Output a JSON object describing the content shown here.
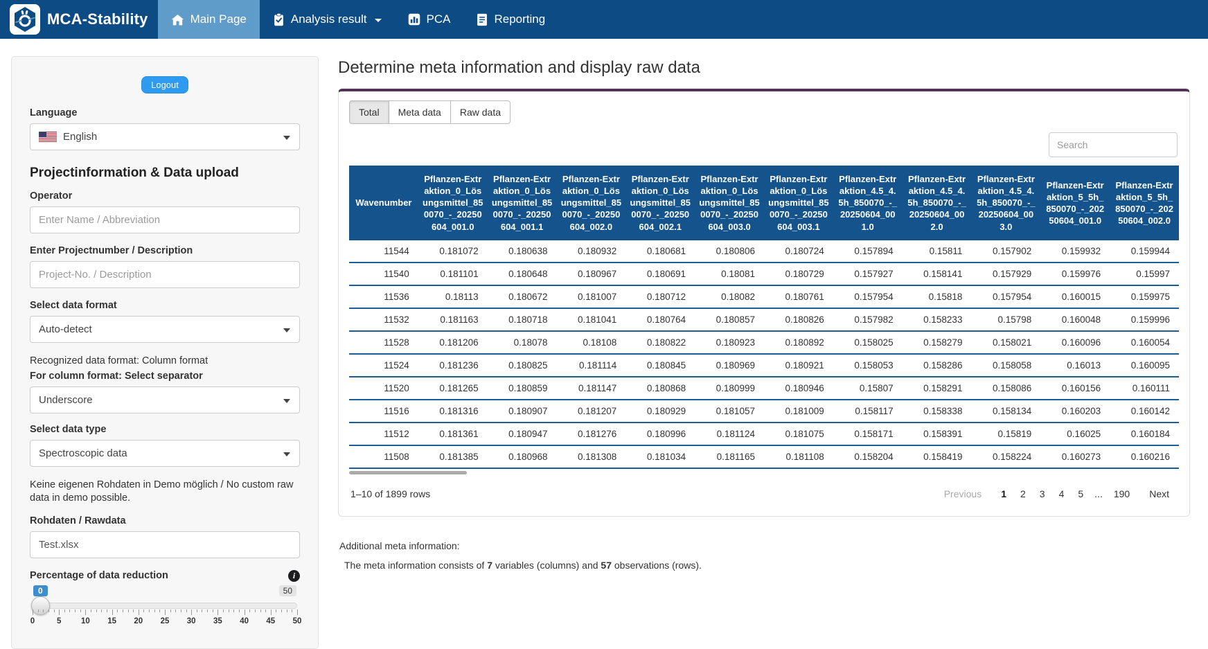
{
  "navbar": {
    "brand": "MCA-Stability",
    "items": [
      {
        "label": "Main Page"
      },
      {
        "label": "Analysis result"
      },
      {
        "label": "PCA"
      },
      {
        "label": "Reporting"
      }
    ]
  },
  "sidebar": {
    "logout_label": "Logout",
    "language": {
      "label": "Language",
      "selected": "English"
    },
    "section_title": "Projectinformation & Data upload",
    "operator": {
      "label": "Operator",
      "placeholder": "Enter Name / Abbreviation"
    },
    "project": {
      "label": "Enter Projectnumber / Description",
      "placeholder": "Project-No. / Description"
    },
    "data_format": {
      "label": "Select data format",
      "selected": "Auto-detect"
    },
    "recognized_format": "Recognized data format: Column format",
    "separator": {
      "label": "For column format: Select separator",
      "selected": "Underscore"
    },
    "data_type": {
      "label": "Select data type",
      "selected": "Spectroscopic data"
    },
    "demo_note": "Keine eigenen Rohdaten in Demo möglich / No custom raw data in demo possible.",
    "rawdata": {
      "label": "Rohdaten / Rawdata",
      "value": "Test.xlsx"
    },
    "reduction": {
      "label": "Percentage of data reduction",
      "value_label": "0",
      "max_label": "50",
      "min": 0,
      "max": 50,
      "major_ticks": [
        0,
        5,
        10,
        15,
        20,
        25,
        30,
        35,
        40,
        45,
        50
      ]
    }
  },
  "main": {
    "title": "Determine meta information and display raw data",
    "tabs": [
      {
        "label": "Total",
        "active": true
      },
      {
        "label": "Meta data",
        "active": false
      },
      {
        "label": "Raw data",
        "active": false
      }
    ],
    "search_placeholder": "Search",
    "table": {
      "columns": [
        "Wavenumber",
        "Pflanzen-Extraktion_0_Lösungsmittel_850070_-_20250604_001.0",
        "Pflanzen-Extraktion_0_Lösungsmittel_850070_-_20250604_001.1",
        "Pflanzen-Extraktion_0_Lösungsmittel_850070_-_20250604_002.0",
        "Pflanzen-Extraktion_0_Lösungsmittel_850070_-_20250604_002.1",
        "Pflanzen-Extraktion_0_Lösungsmittel_850070_-_20250604_003.0",
        "Pflanzen-Extraktion_0_Lösungsmittel_850070_-_20250604_003.1",
        "Pflanzen-Extraktion_4.5_4.5h_850070_-_20250604_001.0",
        "Pflanzen-Extraktion_4.5_4.5h_850070_-_20250604_002.0",
        "Pflanzen-Extraktion_4.5_4.5h_850070_-_20250604_003.0",
        "Pflanzen-Extraktion_5_5h_850070_-_20250604_001.0",
        "Pflanzen-Extraktion_5_5h_850070_-_20250604_002.0"
      ],
      "rows": [
        [
          "11544",
          "0.181072",
          "0.180638",
          "0.180932",
          "0.180681",
          "0.180806",
          "0.180724",
          "0.157894",
          "0.15811",
          "0.157902",
          "0.159932",
          "0.159944"
        ],
        [
          "11540",
          "0.181101",
          "0.180648",
          "0.180967",
          "0.180691",
          "0.18081",
          "0.180729",
          "0.157927",
          "0.158141",
          "0.157929",
          "0.159976",
          "0.15997"
        ],
        [
          "11536",
          "0.18113",
          "0.180672",
          "0.181007",
          "0.180712",
          "0.18082",
          "0.180761",
          "0.157954",
          "0.15818",
          "0.157954",
          "0.160015",
          "0.159975"
        ],
        [
          "11532",
          "0.181163",
          "0.180718",
          "0.181041",
          "0.180764",
          "0.180857",
          "0.180826",
          "0.157982",
          "0.158233",
          "0.15798",
          "0.160048",
          "0.159996"
        ],
        [
          "11528",
          "0.181206",
          "0.18078",
          "0.18108",
          "0.180822",
          "0.180923",
          "0.180892",
          "0.158025",
          "0.158279",
          "0.158021",
          "0.160096",
          "0.160054"
        ],
        [
          "11524",
          "0.181236",
          "0.180825",
          "0.181114",
          "0.180845",
          "0.180969",
          "0.180921",
          "0.158053",
          "0.158286",
          "0.158058",
          "0.16013",
          "0.160095"
        ],
        [
          "11520",
          "0.181265",
          "0.180859",
          "0.181147",
          "0.180868",
          "0.180999",
          "0.180946",
          "0.15807",
          "0.158291",
          "0.158086",
          "0.160156",
          "0.160111"
        ],
        [
          "11516",
          "0.181316",
          "0.180907",
          "0.181207",
          "0.180929",
          "0.181057",
          "0.181009",
          "0.158117",
          "0.158338",
          "0.158134",
          "0.160203",
          "0.160142"
        ],
        [
          "11512",
          "0.181361",
          "0.180947",
          "0.181276",
          "0.180996",
          "0.181124",
          "0.181075",
          "0.158171",
          "0.158391",
          "0.15819",
          "0.16025",
          "0.160184"
        ],
        [
          "11508",
          "0.181385",
          "0.180968",
          "0.181308",
          "0.181034",
          "0.181165",
          "0.181108",
          "0.158204",
          "0.158419",
          "0.158224",
          "0.160273",
          "0.160216"
        ]
      ]
    },
    "footer": {
      "info": "1–10 of 1899 rows",
      "pagination": [
        {
          "label": "Previous",
          "type": "disabled"
        },
        {
          "label": "1",
          "type": "current"
        },
        {
          "label": "2",
          "type": "page"
        },
        {
          "label": "3",
          "type": "page"
        },
        {
          "label": "4",
          "type": "page"
        },
        {
          "label": "5",
          "type": "page"
        },
        {
          "label": "...",
          "type": "ellipsis"
        },
        {
          "label": "190",
          "type": "page"
        },
        {
          "label": "Next",
          "type": "next"
        }
      ]
    },
    "meta_note_title": "Additional meta information:",
    "meta_note": {
      "prefix": "The meta information consists of ",
      "vars": "7",
      "middle": " variables (columns) and ",
      "obs": "57",
      "suffix": " observations (rows)."
    }
  },
  "colors": {
    "navbar": "#0c4b84",
    "navbar_active": "#5f9cc9",
    "table_header": "#14538c",
    "row_border": "#1c5d97",
    "card_top_border": "#543156",
    "accent_blue": "#2e9bf0"
  }
}
